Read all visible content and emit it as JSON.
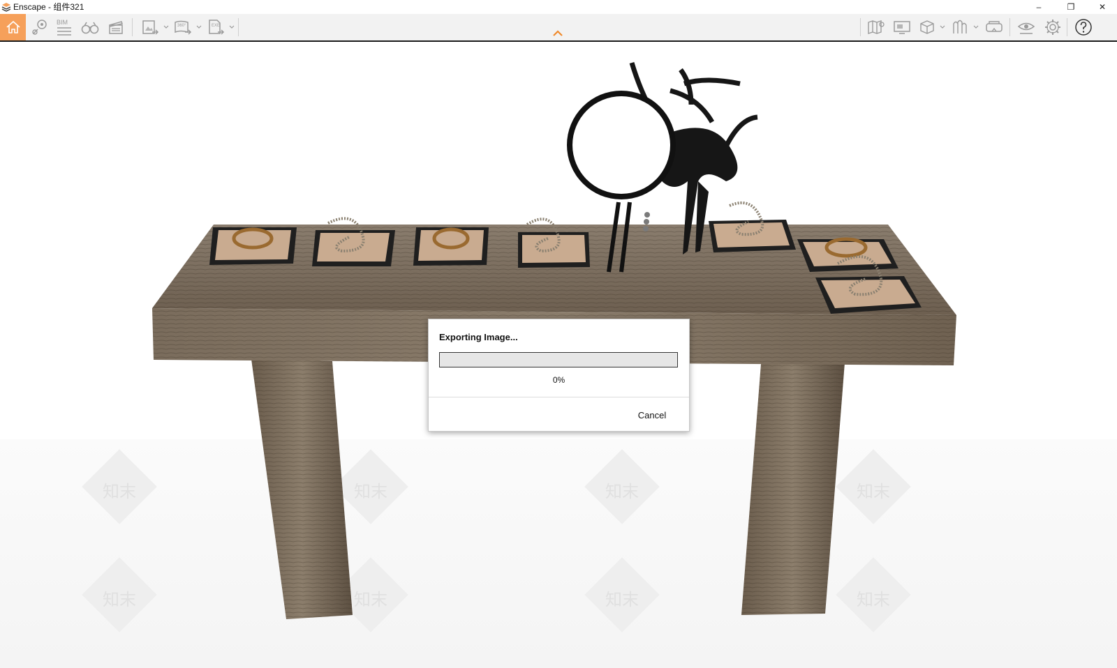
{
  "window": {
    "title": "Enscape - 组件321",
    "minimize_glyph": "–",
    "restore_glyph": "❐",
    "close_glyph": "✕"
  },
  "toolbar": {
    "bim_label": "BIM",
    "pano_label": "360°",
    "exe_label": "EXE",
    "left_icons": [
      "home-icon",
      "map-pin-icon",
      "bim-icon",
      "binoculars-icon",
      "clapperboard-icon",
      "export-image-icon",
      "export-panorama-icon",
      "export-exe-icon"
    ],
    "right_icons": [
      "map-icon",
      "monitor-icon",
      "cube-icon",
      "asset-library-icon",
      "vr-headset-icon",
      "visual-settings-icon",
      "settings-gear-icon",
      "help-icon"
    ],
    "accent_color": "#f6a05a"
  },
  "dialog": {
    "title": "Exporting Image...",
    "progress": 0,
    "progress_text": "0%",
    "cancel_label": "Cancel"
  },
  "viewport": {
    "watermark_text": "知末"
  }
}
